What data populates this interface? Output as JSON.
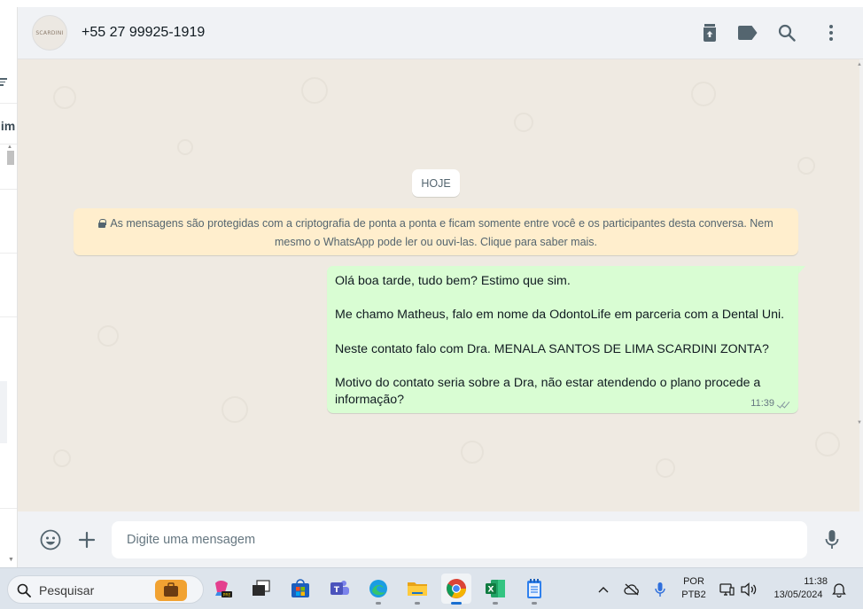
{
  "chat": {
    "contact_name": "+55 27 99925-1919",
    "avatar_text": "SCARDINI"
  },
  "icons": {
    "header": [
      "archive-icon",
      "label-icon",
      "search-icon",
      "menu-icon"
    ],
    "composer": [
      "emoji-icon",
      "attach-icon",
      "mic-icon"
    ]
  },
  "conversation": {
    "date_chip": "HOJE",
    "encryption_notice": "As mensagens são protegidas com a criptografia de ponta a ponta e ficam somente entre você e os participantes desta conversa. Nem mesmo o WhatsApp pode ler ou ouvi-las. Clique para saber mais.",
    "message": {
      "lines": [
        "Olá boa tarde, tudo bem? Estimo que sim.",
        "",
        "Me chamo Matheus, falo em nome da OdontoLife em parceria com a Dental Uni.",
        "",
        "Neste contato falo com Dra. MENALA SANTOS DE LIMA SCARDINI ZONTA?",
        "",
        "Motivo do contato seria sobre a Dra, não estar atendendo o plano procede a",
        "informação?"
      ],
      "time": "11:39",
      "status": "delivered"
    }
  },
  "composer": {
    "placeholder": "Digite uma mensagem"
  },
  "sidebar_partial": {
    "text": "lim"
  },
  "taskbar": {
    "search_label": "Pesquisar",
    "language": "POR",
    "layout": "PTB2",
    "time": "11:38",
    "date": "13/05/2024"
  },
  "colors": {
    "header_bg": "#f0f2f5",
    "chat_bg": "#efeae2",
    "outgoing_bubble": "#d9fdd3",
    "system_note": "#ffeecd",
    "taskbar_bg": "#dde4ec"
  }
}
